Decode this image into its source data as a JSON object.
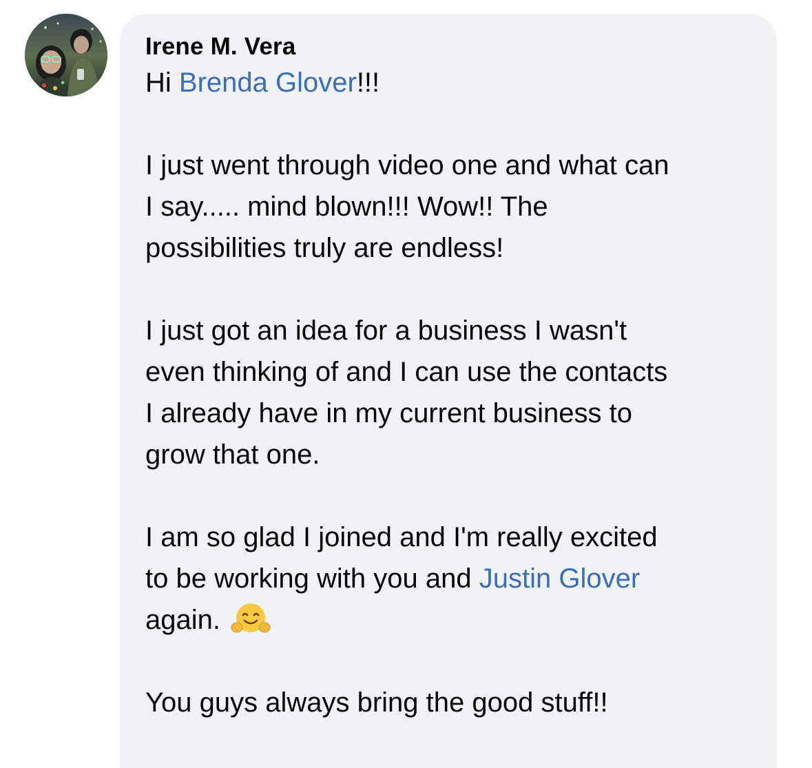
{
  "comment": {
    "author_name": "Irene M. Vera",
    "greeting": {
      "prefix": "Hi ",
      "mention": "Brenda Glover",
      "suffix": "!!!"
    },
    "paragraph_1": {
      "line_1": "I just went through video one and what can",
      "line_2": "I say..... mind blown!!! Wow!! The",
      "line_3": "possibilities truly are endless!"
    },
    "paragraph_2": {
      "line_1": "I just got an idea for a business I wasn't",
      "line_2": "even thinking of and I can use the contacts",
      "line_3": "I already have in my current business to",
      "line_4": "grow that one."
    },
    "paragraph_3": {
      "line_1": "I am so glad I joined and I'm really excited",
      "line_2_prefix": "to be working with you and ",
      "line_2_mention": "Justin Glover",
      "line_3": "again. ",
      "emoji": "hugging-face-emoji"
    },
    "paragraph_4": "You guys always bring the good stuff!!",
    "colors": {
      "bubble_background": "#f0f2f5",
      "mention": "#3a6fb7",
      "text": "#050505"
    }
  }
}
